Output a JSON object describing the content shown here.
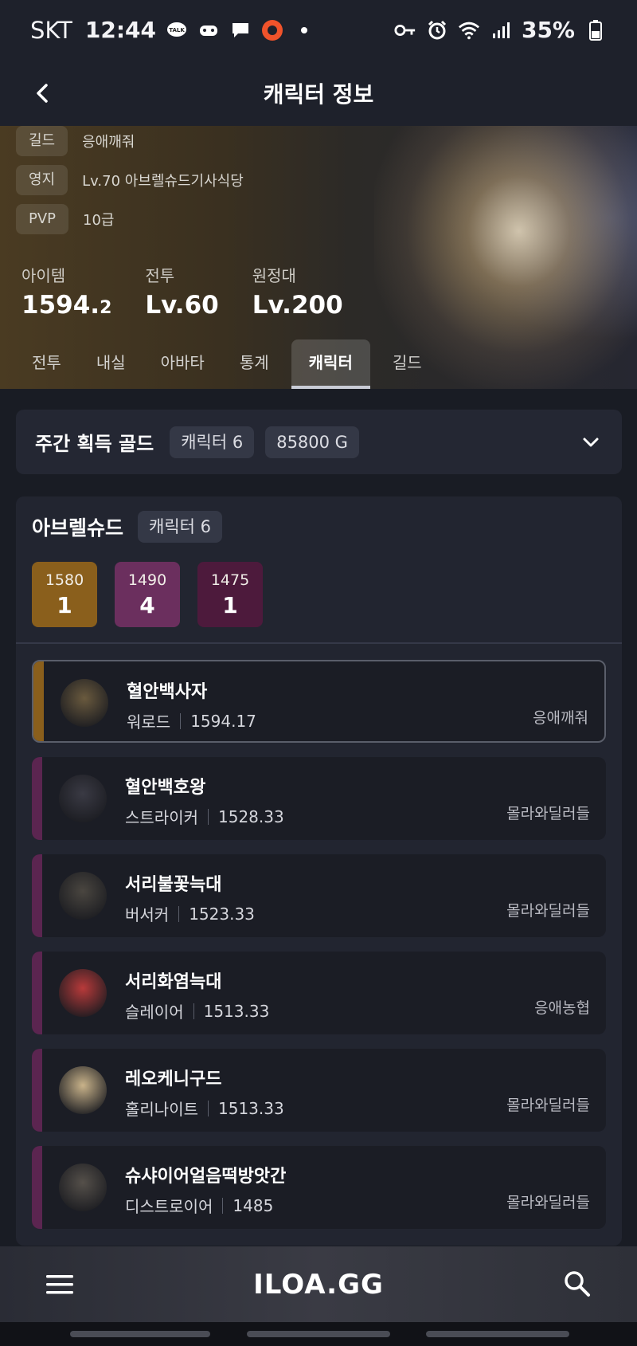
{
  "status_bar": {
    "carrier": "SKT",
    "time": "12:44",
    "battery": "35%"
  },
  "header": {
    "title": "캐릭터 정보"
  },
  "profile": {
    "info": [
      {
        "tag": "길드",
        "value": "응애깨줘"
      },
      {
        "tag": "영지",
        "value": "Lv.70 아브렐슈드기사식당"
      },
      {
        "tag": "PVP",
        "value": "10급"
      }
    ],
    "stats": [
      {
        "label": "아이템",
        "value_main": "1594.",
        "value_small": "2"
      },
      {
        "label": "전투",
        "value_main": "Lv.60",
        "value_small": ""
      },
      {
        "label": "원정대",
        "value_main": "Lv.200",
        "value_small": ""
      }
    ],
    "tabs": [
      "전투",
      "내실",
      "아바타",
      "통계",
      "캐릭터",
      "길드"
    ],
    "active_tab": "캐릭터"
  },
  "weekly_gold": {
    "title": "주간 획득 골드",
    "character_count": "캐릭터 6",
    "gold": "85800 G"
  },
  "server": {
    "name": "아브렐슈드",
    "character_count": "캐릭터 6",
    "levels": [
      {
        "level": "1580",
        "count": "1",
        "color": "#8a5f1c"
      },
      {
        "level": "1490",
        "count": "4",
        "color": "#6b2f5e"
      },
      {
        "level": "1475",
        "count": "1",
        "color": "#4d1a3c"
      }
    ],
    "characters": [
      {
        "name": "혈안백사자",
        "class": "워로드",
        "item_level": "1594.17",
        "guild": "응애깨줘",
        "bar_color": "#8a5f1c",
        "avatar_color": "#6a5a3e"
      },
      {
        "name": "혈안백호왕",
        "class": "스트라이커",
        "item_level": "1528.33",
        "guild": "몰라와딜러들",
        "bar_color": "#5b2550",
        "avatar_color": "#3a3a44"
      },
      {
        "name": "서리불꽃늑대",
        "class": "버서커",
        "item_level": "1523.33",
        "guild": "몰라와딜러들",
        "bar_color": "#5b2550",
        "avatar_color": "#4a4640"
      },
      {
        "name": "서리화염늑대",
        "class": "슬레이어",
        "item_level": "1513.33",
        "guild": "응애농협",
        "bar_color": "#5b2550",
        "avatar_color": "#b83a3a"
      },
      {
        "name": "레오케니구드",
        "class": "홀리나이트",
        "item_level": "1513.33",
        "guild": "몰라와딜러들",
        "bar_color": "#5b2550",
        "avatar_color": "#c9b38a"
      },
      {
        "name": "슈샤이어얼음떡방앗간",
        "class": "디스트로이어",
        "item_level": "1485",
        "guild": "몰라와딜러들",
        "bar_color": "#5b2550",
        "avatar_color": "#55504a"
      }
    ]
  },
  "bottom_nav": {
    "logo": "ILOA.GG"
  }
}
